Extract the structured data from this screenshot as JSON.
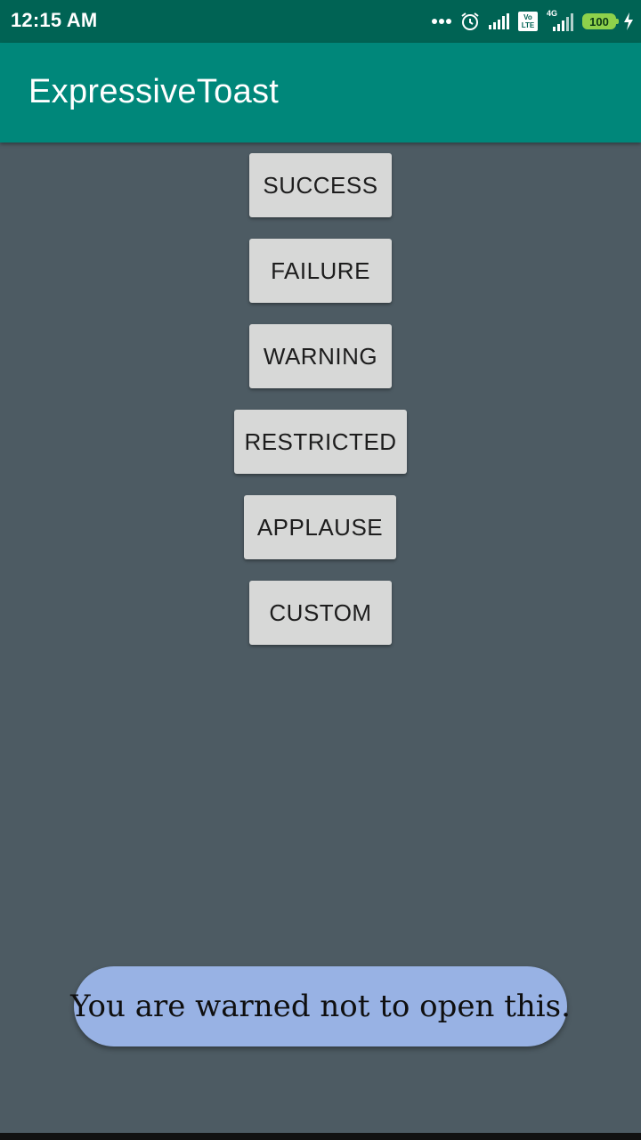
{
  "status_bar": {
    "time": "12:15 AM",
    "volte_top": "Vo",
    "volte_bottom": "LTE",
    "network_label": "4G",
    "battery": "100",
    "icons": [
      "more-dots-icon",
      "alarm-icon",
      "signal-icon",
      "volte-icon",
      "signal-4g-icon",
      "battery-icon",
      "charging-icon"
    ]
  },
  "app_bar": {
    "title": "ExpressiveToast"
  },
  "buttons": [
    {
      "label": "SUCCESS"
    },
    {
      "label": "FAILURE"
    },
    {
      "label": "WARNING"
    },
    {
      "label": "RESTRICTED"
    },
    {
      "label": "APPLAUSE"
    },
    {
      "label": "CUSTOM"
    }
  ],
  "toast": {
    "message": "You are warned not to open this."
  },
  "colors": {
    "status_bar": "#006354",
    "app_bar": "#00877a",
    "background": "#4d5b63",
    "button": "#d7d8d7",
    "toast": "#98b2e4",
    "battery": "#8ed14b"
  }
}
